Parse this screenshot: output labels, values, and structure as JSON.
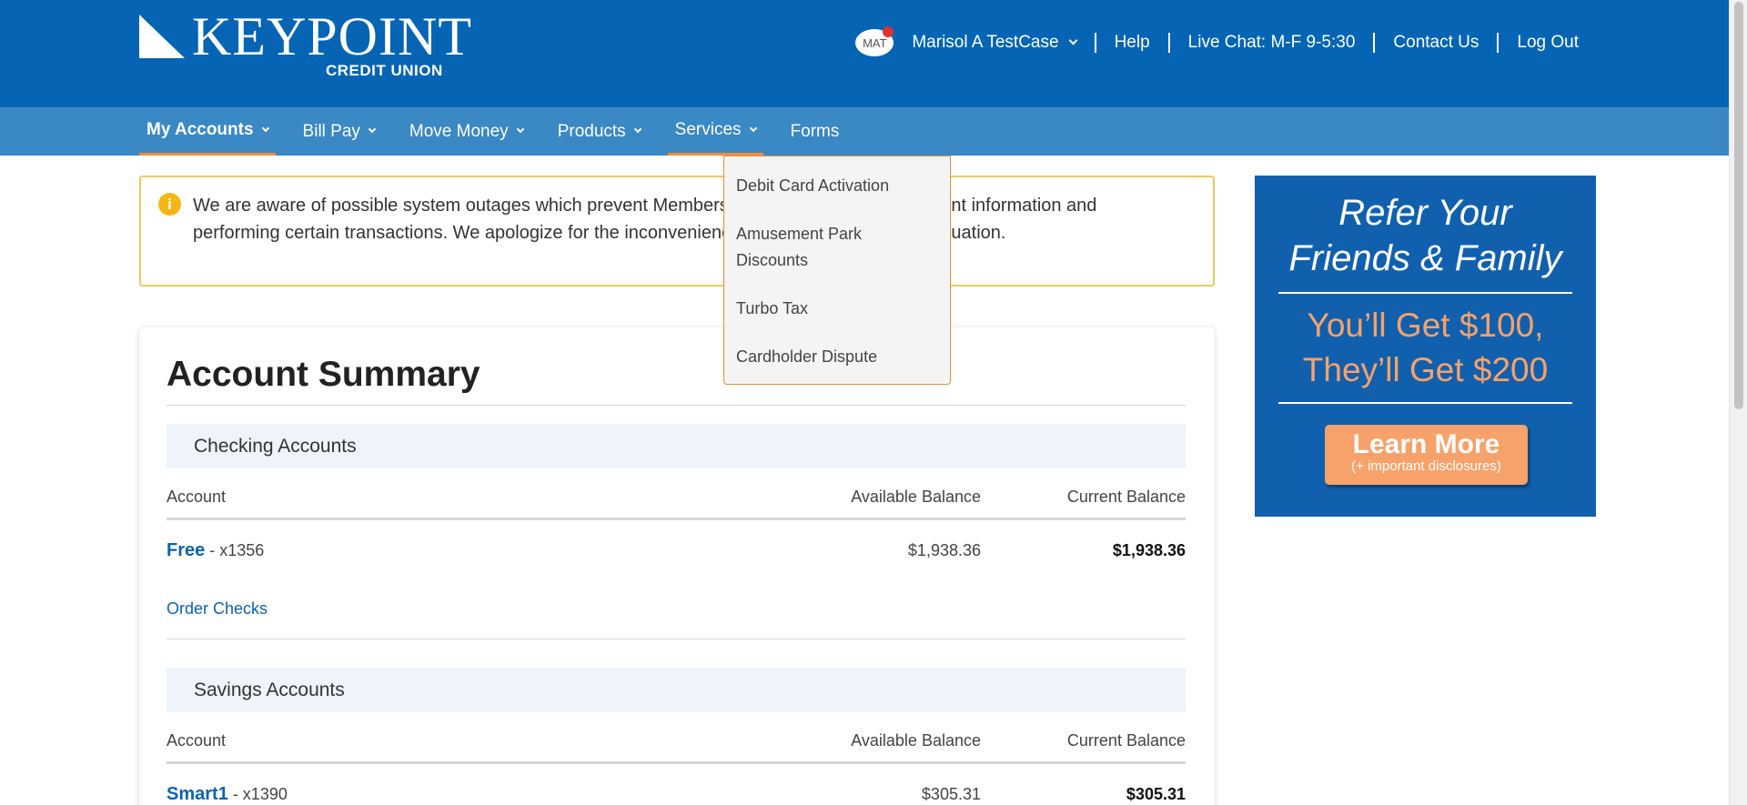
{
  "brand": {
    "name": "KEYPOINT",
    "sub": "CREDIT UNION"
  },
  "header": {
    "avatar_initials": "MAT",
    "user_name": "Marisol A TestCase",
    "links": [
      "Help",
      "Live Chat: M-F 9-5:30",
      "Contact Us",
      "Log Out"
    ]
  },
  "nav": {
    "items": [
      {
        "label": "My Accounts"
      },
      {
        "label": "Bill Pay"
      },
      {
        "label": "Move Money"
      },
      {
        "label": "Products"
      },
      {
        "label": "Services"
      },
      {
        "label": "Forms"
      }
    ]
  },
  "services_menu": {
    "items": [
      "Debit Card Activation",
      "Amusement Park Discounts",
      "Turbo Tax",
      "Cardholder Dispute"
    ]
  },
  "alert": {
    "text": "We are aware of possible system outages which prevent Members from viewing current account information and performing certain transactions. We apologize for the inconvenience and are monitoring the situation."
  },
  "summary": {
    "title": "Account Summary",
    "columns": {
      "account": "Account",
      "available": "Available Balance",
      "current": "Current Balance"
    },
    "checking": {
      "heading": "Checking Accounts",
      "accounts": [
        {
          "name": "Free",
          "number": " - x1356",
          "available": "$1,938.36",
          "current": "$1,938.36"
        }
      ],
      "order_checks": "Order Checks"
    },
    "savings": {
      "heading": "Savings Accounts",
      "accounts": [
        {
          "name": "Smart1",
          "number": " - x1390",
          "available": "$305.31",
          "current": "$305.31"
        }
      ]
    }
  },
  "promo": {
    "line1": "Refer Your",
    "line2": "Friends & Family",
    "line3": "You’ll Get $100,",
    "line4": "They’ll Get $200",
    "button": "Learn More",
    "button_sub": "(+ important disclosures)"
  }
}
